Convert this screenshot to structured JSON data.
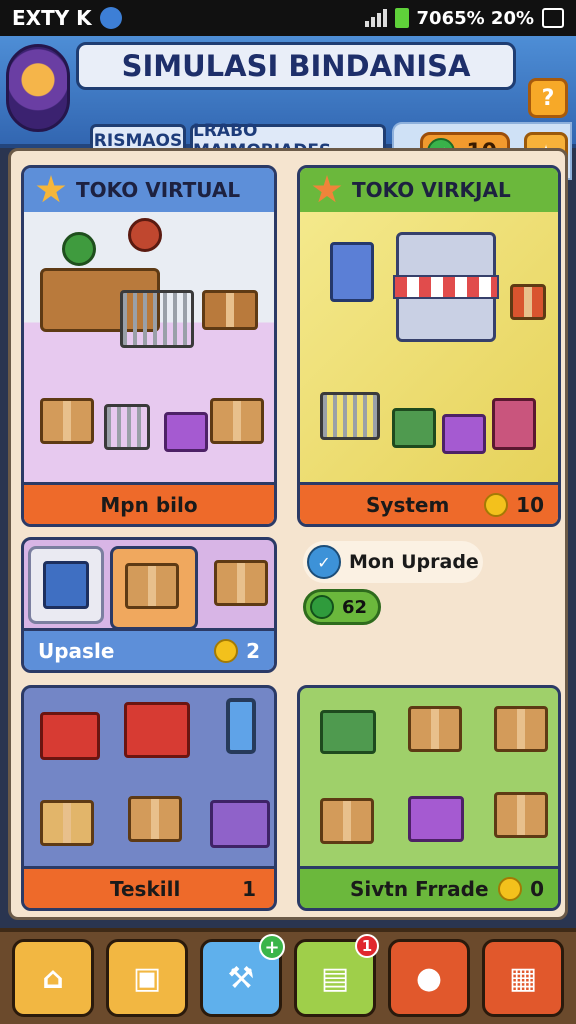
{
  "status_bar": {
    "left_text": "EXTY K",
    "right_text": "7065% 20%"
  },
  "header": {
    "title": "SIMULASI BINDANISA",
    "tabs": [
      "RISMAOS",
      "LRABO MAIMOBIADES"
    ],
    "currency_value": "10"
  },
  "cards": {
    "left_top": {
      "title": "TOKO VIRTUAL",
      "footer": "Mpn bilo"
    },
    "right_top": {
      "title": "TOKO VIRKJAL",
      "footer": "System",
      "footer_value": "10"
    },
    "upgrade_row": {
      "label": "Upasle",
      "value": "2"
    },
    "mission": {
      "label": "Mon Uprade",
      "value": "62"
    },
    "left_bottom": {
      "footer": "Teskill",
      "value": "1"
    },
    "right_bottom": {
      "footer": "Sivtn Frrade",
      "value": "0"
    }
  },
  "bottom_nav": {
    "items": [
      "home-icon",
      "bag-icon",
      "build-icon",
      "cards-icon",
      "chat-icon",
      "shop-icon"
    ],
    "notification_count": "1",
    "plus_symbol": "+"
  },
  "colors": {
    "header_blue": "#3266b1",
    "orange": "#ee6a2a",
    "green": "#6bb83c",
    "panel_bg": "#f5e4cf"
  }
}
